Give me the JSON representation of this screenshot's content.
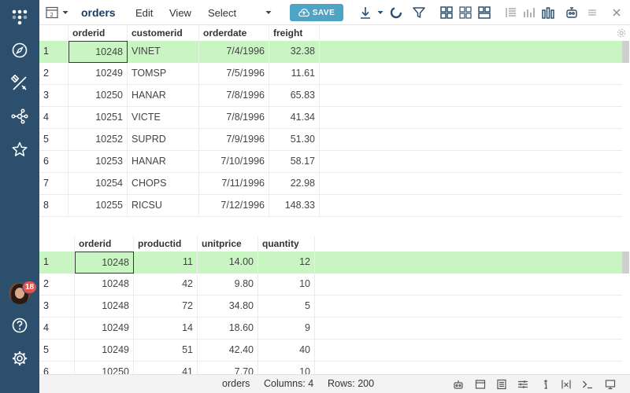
{
  "app": {
    "title": "orders",
    "menu": {
      "edit": "Edit",
      "view": "View",
      "select": "Select"
    },
    "save_label": "SAVE",
    "view_switch_num": "2",
    "sidebar": {
      "notification_count": "18"
    },
    "colors": {
      "sidebar": "#2c4f6e",
      "accent": "#4fa3c4",
      "selection": "#c9f5c3",
      "badge": "#e0544d",
      "title": "#1a3e63"
    }
  },
  "grid1": {
    "columns": [
      "orderid",
      "customerid",
      "orderdate",
      "freight"
    ],
    "rows": [
      {
        "n": "1",
        "orderid": "10248",
        "customerid": "VINET",
        "orderdate": "7/4/1996",
        "freight": "32.38"
      },
      {
        "n": "2",
        "orderid": "10249",
        "customerid": "TOMSP",
        "orderdate": "7/5/1996",
        "freight": "11.61"
      },
      {
        "n": "3",
        "orderid": "10250",
        "customerid": "HANAR",
        "orderdate": "7/8/1996",
        "freight": "65.83"
      },
      {
        "n": "4",
        "orderid": "10251",
        "customerid": "VICTE",
        "orderdate": "7/8/1996",
        "freight": "41.34"
      },
      {
        "n": "5",
        "orderid": "10252",
        "customerid": "SUPRD",
        "orderdate": "7/9/1996",
        "freight": "51.30"
      },
      {
        "n": "6",
        "orderid": "10253",
        "customerid": "HANAR",
        "orderdate": "7/10/1996",
        "freight": "58.17"
      },
      {
        "n": "7",
        "orderid": "10254",
        "customerid": "CHOPS",
        "orderdate": "7/11/1996",
        "freight": "22.98"
      },
      {
        "n": "8",
        "orderid": "10255",
        "customerid": "RICSU",
        "orderdate": "7/12/1996",
        "freight": "148.33"
      }
    ]
  },
  "grid2": {
    "columns": [
      "orderid",
      "productid",
      "unitprice",
      "quantity"
    ],
    "rows": [
      {
        "n": "1",
        "orderid": "10248",
        "productid": "11",
        "unitprice": "14.00",
        "quantity": "12"
      },
      {
        "n": "2",
        "orderid": "10248",
        "productid": "42",
        "unitprice": "9.80",
        "quantity": "10"
      },
      {
        "n": "3",
        "orderid": "10248",
        "productid": "72",
        "unitprice": "34.80",
        "quantity": "5"
      },
      {
        "n": "4",
        "orderid": "10249",
        "productid": "14",
        "unitprice": "18.60",
        "quantity": "9"
      },
      {
        "n": "5",
        "orderid": "10249",
        "productid": "51",
        "unitprice": "42.40",
        "quantity": "40"
      },
      {
        "n": "6",
        "orderid": "10250",
        "productid": "41",
        "unitprice": "7.70",
        "quantity": "10"
      }
    ]
  },
  "status": {
    "table": "orders",
    "columns": "Columns: 4",
    "rows": "Rows: 200"
  }
}
